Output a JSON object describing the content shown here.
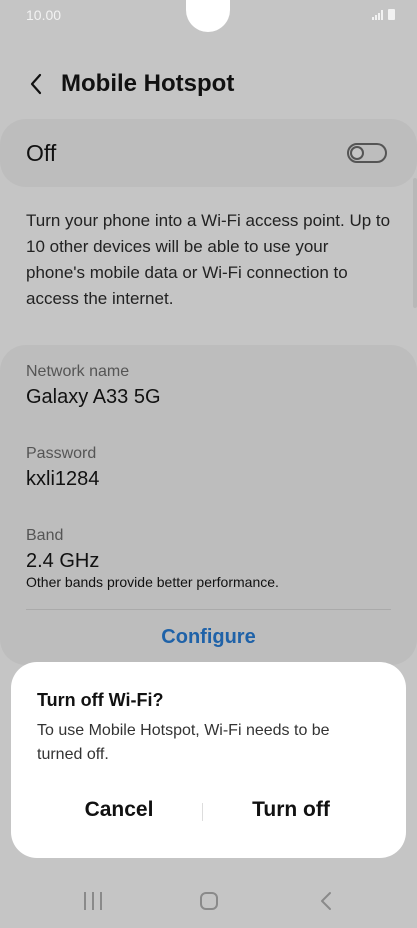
{
  "status_bar": {
    "time": "10.00"
  },
  "header": {
    "title": "Mobile Hotspot"
  },
  "hotspot_toggle": {
    "label": "Off",
    "state": "off"
  },
  "description": "Turn your phone into a Wi-Fi access point. Up to 10 other devices will be able to use your phone's mobile data or Wi-Fi connection to access the internet.",
  "network": {
    "name_label": "Network name",
    "name_value": "Galaxy A33 5G",
    "password_label": "Password",
    "password_value": "kxli1284",
    "band_label": "Band",
    "band_value": "2.4 GHz",
    "band_note": "Other bands provide better performance.",
    "configure_label": "Configure"
  },
  "dialog": {
    "title": "Turn off Wi-Fi?",
    "message": "To use Mobile Hotspot, Wi-Fi needs to be turned off.",
    "cancel_label": "Cancel",
    "confirm_label": "Turn off"
  },
  "colors": {
    "accent": "#1f62a8",
    "dim_background": "#c5c5c5",
    "dialog_background": "#ffffff"
  },
  "icons": {
    "back": "chevron-left-icon",
    "signal": "signal-icon",
    "battery": "battery-icon",
    "nav_recent": "recent-apps-icon",
    "nav_home": "home-icon",
    "nav_back": "back-icon"
  }
}
